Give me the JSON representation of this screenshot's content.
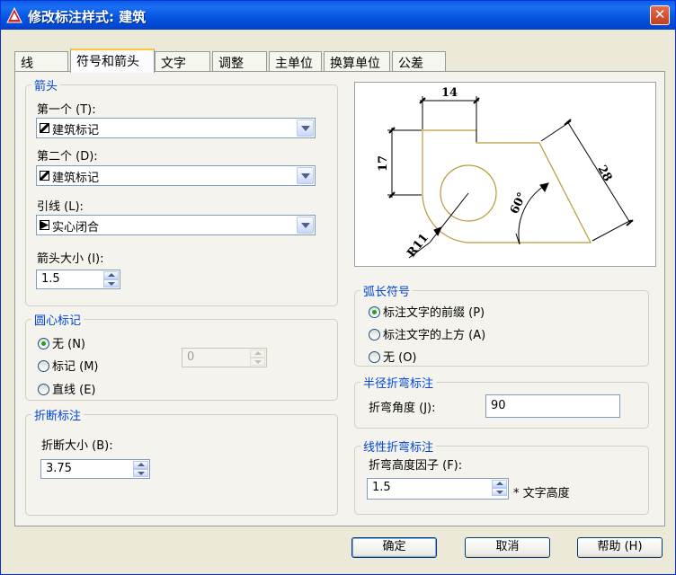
{
  "window": {
    "title": "修改标注样式: 建筑",
    "close_glyph": "✕"
  },
  "tabs": [
    {
      "label": "线"
    },
    {
      "label": "符号和箭头",
      "active": true
    },
    {
      "label": "文字"
    },
    {
      "label": "调整"
    },
    {
      "label": "主单位"
    },
    {
      "label": "换算单位"
    },
    {
      "label": "公差"
    }
  ],
  "arrowheads": {
    "group_title": "箭头",
    "first_label": "第一个 (T):",
    "first_value": "建筑标记",
    "second_label": "第二个 (D):",
    "second_value": "建筑标记",
    "leader_label": "引线 (L):",
    "leader_value": "实心闭合",
    "size_label": "箭头大小 (I):",
    "size_value": "1.5"
  },
  "center_marks": {
    "group_title": "圆心标记",
    "options": [
      "无 (N)",
      "标记 (M)",
      "直线 (E)"
    ],
    "selected": "无 (N)",
    "size_value": "0"
  },
  "dim_break": {
    "group_title": "折断标注",
    "size_label": "折断大小 (B):",
    "size_value": "3.75"
  },
  "preview": {
    "dim_top": "14",
    "dim_left": "17",
    "dim_diag": "28",
    "angle": "60°",
    "radius": "R11"
  },
  "arc_length": {
    "group_title": "弧长符号",
    "options": [
      "标注文字的前缀 (P)",
      "标注文字的上方 (A)",
      "无 (O)"
    ],
    "selected": "标注文字的前缀 (P)"
  },
  "radius_jog": {
    "group_title": "半径折弯标注",
    "angle_label": "折弯角度 (J):",
    "angle_value": "90"
  },
  "linear_jog": {
    "group_title": "线性折弯标注",
    "factor_label": "折弯高度因子 (F):",
    "factor_value": "1.5",
    "suffix": "* 文字高度"
  },
  "buttons": {
    "ok": "确定",
    "cancel": "取消",
    "help": "帮助 (H)"
  },
  "colors": {
    "accent": "#0046d5",
    "titlebar": "#0a5ee8",
    "preview_geometry": "#b89a3a",
    "selected_radio": "#21a121"
  }
}
